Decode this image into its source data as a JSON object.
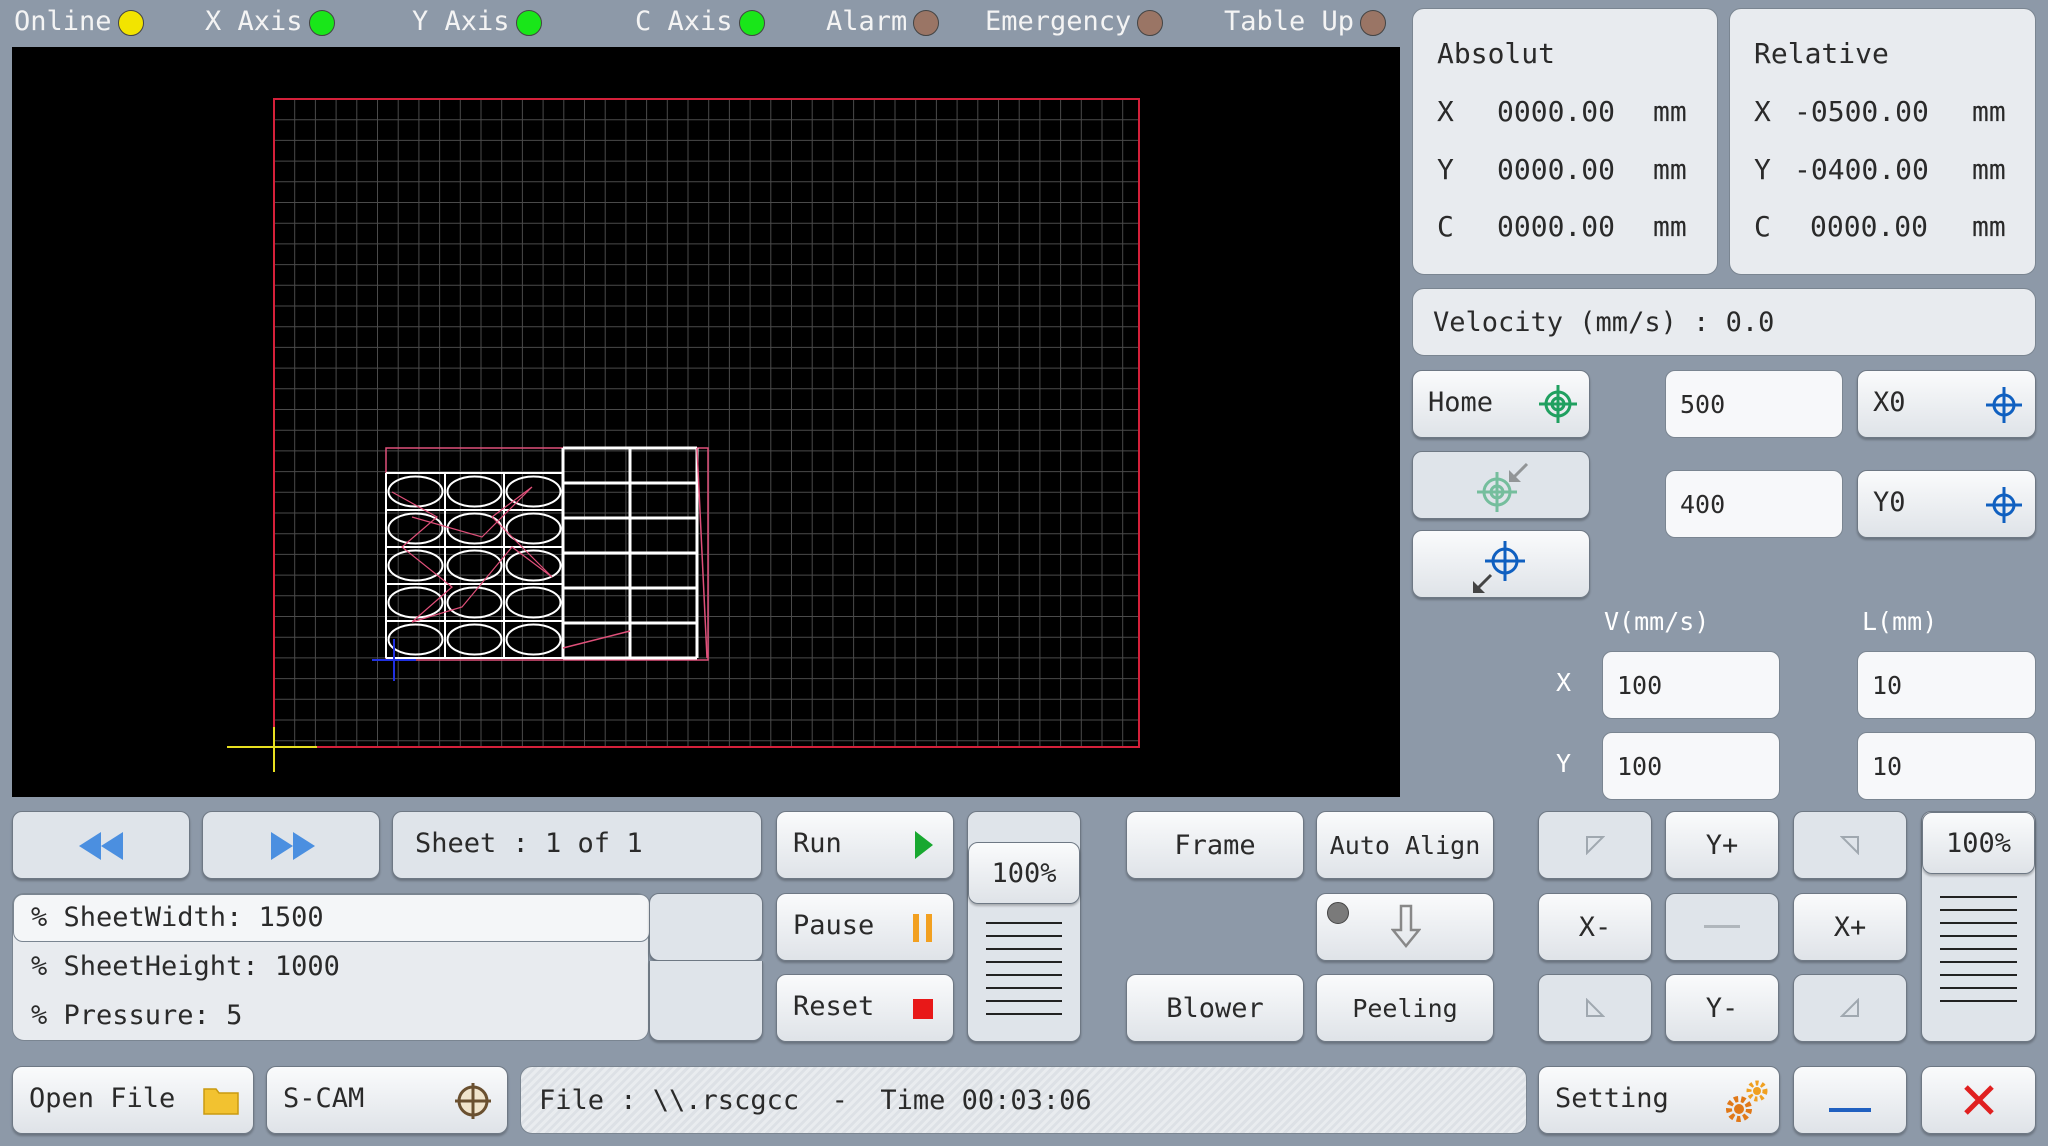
{
  "status": {
    "online": {
      "label": "Online",
      "color": "#f2e400"
    },
    "x_axis": {
      "label": "X Axis",
      "color": "#19e619"
    },
    "y_axis": {
      "label": "Y Axis",
      "color": "#19e619"
    },
    "c_axis": {
      "label": "C Axis",
      "color": "#19e619"
    },
    "alarm": {
      "label": "Alarm",
      "color": "#9a7565"
    },
    "emergency": {
      "label": "Emergency",
      "color": "#9a7565"
    },
    "table_up": {
      "label": "Table Up",
      "color": "#9a7565"
    }
  },
  "absolute": {
    "title": "Absolut",
    "x_label": "X",
    "x_value": "0000.00",
    "x_unit": "mm",
    "y_label": "Y",
    "y_value": "0000.00",
    "y_unit": "mm",
    "c_label": "C",
    "c_value": "0000.00",
    "c_unit": "mm"
  },
  "relative": {
    "title": "Relative",
    "x_label": "X",
    "x_value": "-0500.00",
    "x_unit": "mm",
    "y_label": "Y",
    "y_value": "-0400.00",
    "y_unit": "mm",
    "c_label": "C",
    "c_value": "0000.00",
    "c_unit": "mm"
  },
  "velocity": {
    "text": "Velocity (mm/s) : 0.0"
  },
  "controls": {
    "home_label": "Home",
    "x0_value": "500",
    "y0_value": "400",
    "x0_label": "X0",
    "y0_label": "Y0"
  },
  "jog": {
    "v_header": "V(mm/s)",
    "l_header": "L(mm)",
    "x_label": "X",
    "y_label": "Y",
    "x_speed": "100",
    "y_speed": "100",
    "x_length": "10",
    "y_length": "10"
  },
  "sheet": {
    "text": "Sheet : 1 of 1"
  },
  "params": {
    "sheet_width": "% SheetWidth: 1500",
    "sheet_height": "% SheetHeight: 1000",
    "pressure": "% Pressure: 5"
  },
  "actions": {
    "run": "Run",
    "pause": "Pause",
    "reset": "Reset",
    "speed_percent": "100%",
    "frame": "Frame",
    "auto_align": "Auto Align",
    "blower": "Blower",
    "peeling": "Peeling"
  },
  "move": {
    "y_plus": "Y+",
    "y_minus": "Y-",
    "x_minus": "X-",
    "x_plus": "X+",
    "percent": "100%"
  },
  "bottom": {
    "open_file": "Open File",
    "scam": "S-CAM",
    "file_info": "File : \\\\.rscgcc  -  Time 00:03:06",
    "setting": "Setting"
  },
  "colors": {
    "canvas_bg": "#000000",
    "sheet_border": "#d4203a",
    "grid": "#4a4a4a",
    "part_stroke": "#ffffff",
    "part_accent": "#e0507a",
    "crosshair": "#e8e020",
    "origin_marker": "#2030e0",
    "nav_arrow": "#4b8fe0",
    "play_green": "#18a830",
    "pause_orange": "#f2a020",
    "stop_red": "#e81818",
    "close_red": "#e02020",
    "minimize_blue": "#2060c0",
    "target_green": "#20a060",
    "target_blue": "#1060c0"
  },
  "icons": {
    "home": "target-icon",
    "goto_origin": "target-arrow-in-icon",
    "set_origin": "target-arrow-out-icon",
    "prev": "double-left-arrow-icon",
    "next": "double-right-arrow-icon",
    "run": "play-icon",
    "pause": "pause-icon",
    "reset": "stop-icon",
    "folder": "folder-icon",
    "scam": "crosshair-icon",
    "setting": "gears-icon",
    "minimize": "minimize-icon",
    "close": "close-icon",
    "down": "down-arrow-icon"
  }
}
